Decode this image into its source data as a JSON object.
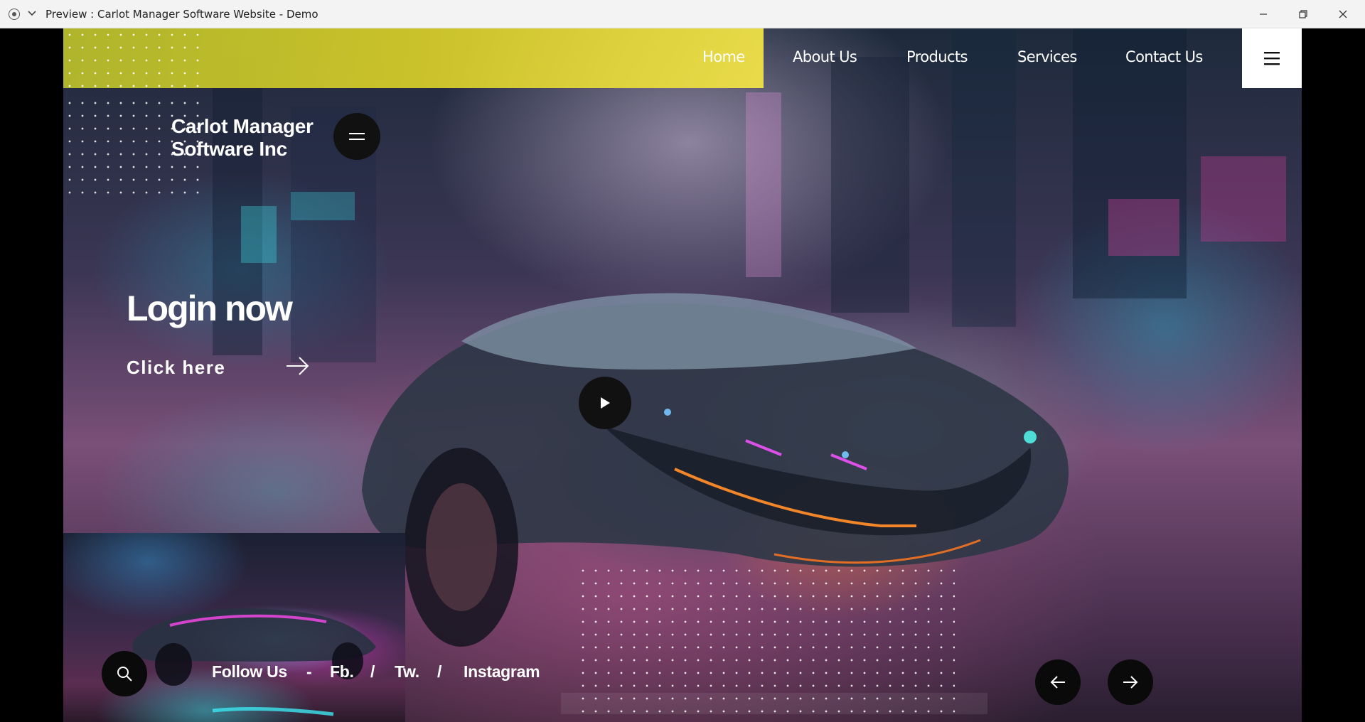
{
  "window": {
    "title": "Preview : Carlot Manager Software Website - Demo",
    "app_icon": "record-icon",
    "controls": [
      "minimize-icon",
      "restore-icon",
      "close-icon"
    ]
  },
  "nav": {
    "items": [
      {
        "label": "Home"
      },
      {
        "label": "About Us"
      },
      {
        "label": "Products"
      },
      {
        "label": "Services"
      },
      {
        "label": "Contact Us"
      }
    ],
    "menu_icon": "hamburger-icon"
  },
  "brand": {
    "line1": "Carlot Manager",
    "line2": "Software Inc"
  },
  "hero": {
    "title": "Login now",
    "cta": "Click here",
    "play_icon": "play-icon"
  },
  "footer": {
    "follow_label": "Follow Us",
    "sep_dash": "-",
    "links": [
      "Fb.",
      "Tw.",
      "Instagram"
    ],
    "sep_slash": "/"
  },
  "colors": {
    "accent_yellow": "#e6dc46",
    "button_dark": "#111111",
    "text": "#ffffff"
  }
}
